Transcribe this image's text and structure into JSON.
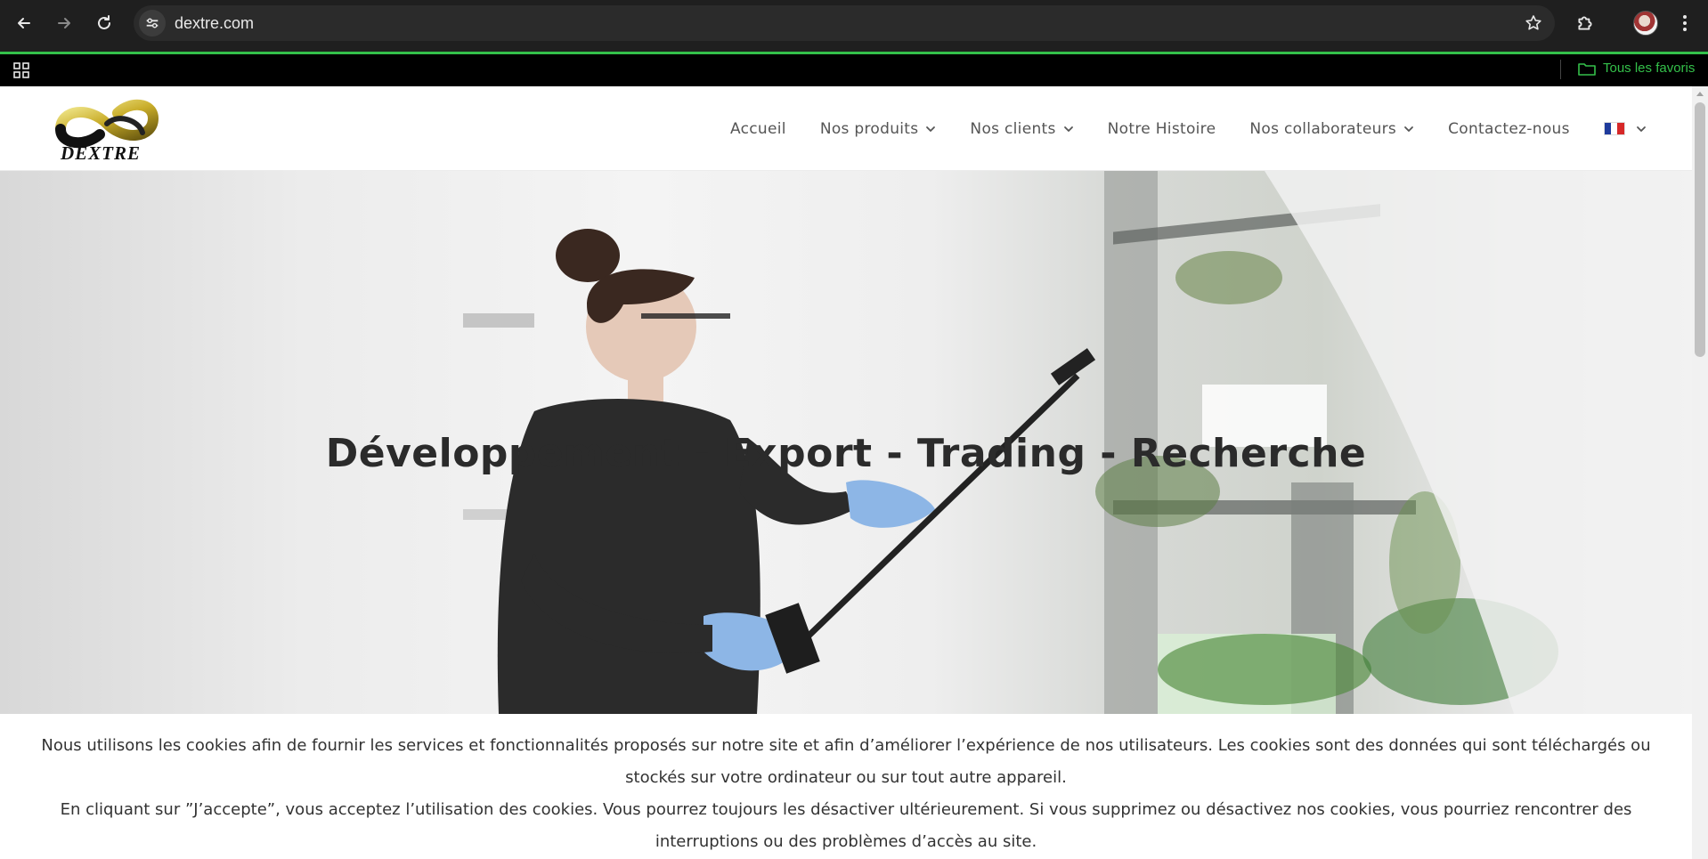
{
  "browser": {
    "url": "dextre.com",
    "bookmarks_folder": "Tous les favoris",
    "accent_color": "#34c04a"
  },
  "site": {
    "logo_text": "DEXTRE",
    "nav": {
      "home": "Accueil",
      "products": "Nos produits",
      "clients": "Nos clients",
      "history": "Notre Histoire",
      "partners": "Nos collaborateurs",
      "contact": "Contactez-nous",
      "language": "fr-flag"
    },
    "hero": {
      "title": "Développement - Export - Trading - Recherche"
    },
    "cookie": {
      "line1": "Nous utilisons les cookies afin de fournir les services et fonctionnalités proposés sur notre site et afin d’améliorer l’expérience de nos utilisateurs. Les cookies sont des données qui sont téléchargés ou stockés sur votre ordinateur ou sur tout autre appareil.",
      "line2": "En cliquant sur ”J’accepte”, vous acceptez l’utilisation des cookies. Vous pourrez toujours les désactiver ultérieurement. Si vous supprimez ou désactivez nos cookies, vous pourriez rencontrer des interruptions ou des problèmes d’accès au site."
    }
  }
}
